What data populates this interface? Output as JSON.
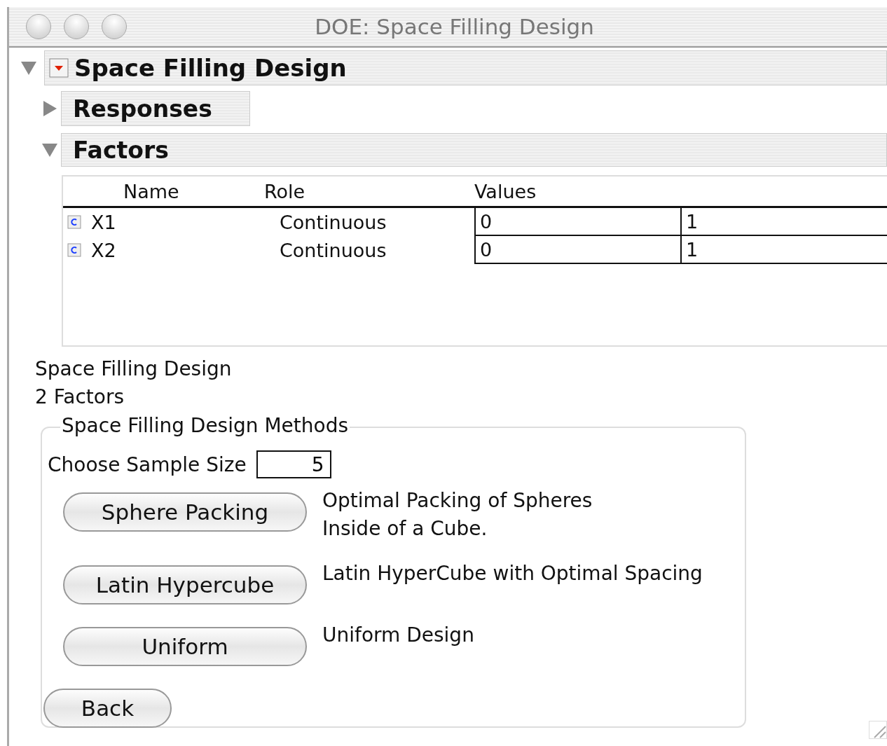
{
  "window": {
    "title": "DOE: Space Filling Design"
  },
  "outline": {
    "title": "Space Filling Design",
    "expanded": true,
    "children": [
      {
        "title": "Responses",
        "expanded": false
      },
      {
        "title": "Factors",
        "expanded": true
      }
    ]
  },
  "factors_table": {
    "columns": [
      "Name",
      "Role",
      "Values"
    ],
    "rows": [
      {
        "name": "X1",
        "role": "Continuous",
        "values": [
          "0",
          "1"
        ]
      },
      {
        "name": "X2",
        "role": "Continuous",
        "values": [
          "0",
          "1"
        ]
      }
    ]
  },
  "summary": [
    "Space Filling Design",
    "2 Factors"
  ],
  "methods": {
    "title": "Space Filling Design Methods",
    "sample_size": {
      "label": "Choose Sample Size",
      "value": "5"
    },
    "options": [
      {
        "button": "Sphere Packing",
        "description": "Optimal Packing of Spheres\nInside of a Cube."
      },
      {
        "button": "Latin Hypercube",
        "description": "Latin HyperCube with Optimal Spacing"
      },
      {
        "button": "Uniform",
        "description": "Uniform Design"
      }
    ],
    "back_button": "Back"
  }
}
